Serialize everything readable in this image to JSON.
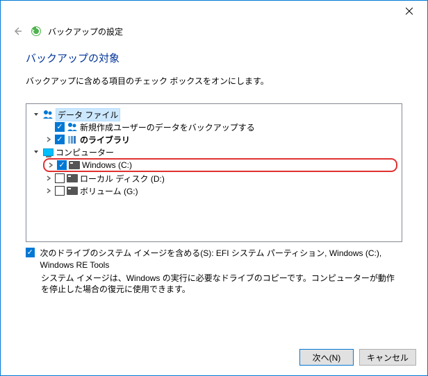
{
  "titlebar": {},
  "header": {
    "title": "バックアップの設定"
  },
  "page": {
    "heading": "バックアップの対象",
    "subtext": "バックアップに含める項目のチェック ボックスをオンにします。"
  },
  "tree": {
    "dataFiles": {
      "label": "データ ファイル",
      "children": [
        {
          "label": "新規作成ユーザーのデータをバックアップする",
          "checked": true
        },
        {
          "label": "のライブラリ",
          "checked": true
        }
      ]
    },
    "computer": {
      "label": "コンピューター",
      "children": [
        {
          "label": "Windows (C:)",
          "checked": true,
          "highlighted": true
        },
        {
          "label": "ローカル ディスク (D:)",
          "checked": false
        },
        {
          "label": "ボリューム (G:)",
          "checked": false
        }
      ]
    }
  },
  "systemImage": {
    "checked": true,
    "label": "次のドライブのシステム イメージを含める(S): EFI システム パーティション, Windows (C:), Windows RE Tools",
    "help": "システム イメージは、Windows の実行に必要なドライブのコピーです。コンピューターが動作を停止した場合の復元に使用できます。"
  },
  "buttons": {
    "next": "次へ(N)",
    "cancel": "キャンセル"
  }
}
